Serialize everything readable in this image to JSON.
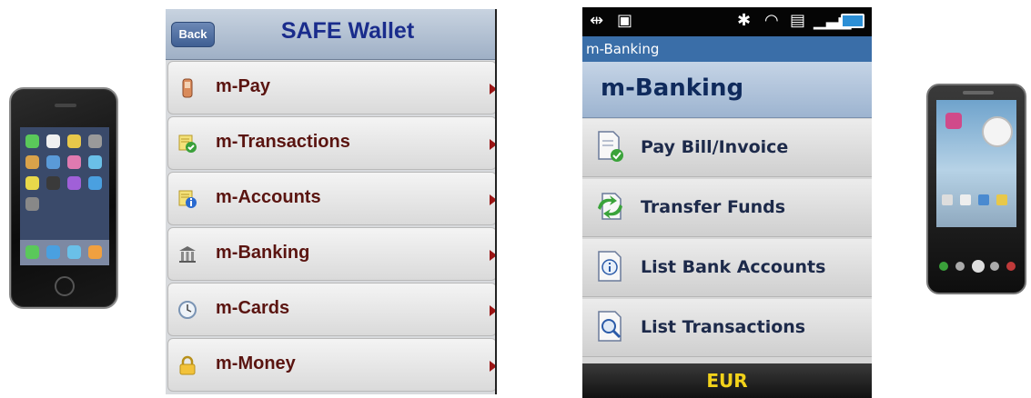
{
  "ios_app": {
    "back_label": "Back",
    "title": "SAFE Wallet",
    "menu": [
      {
        "label": "m-Pay",
        "icon": "phone-icon"
      },
      {
        "label": "m-Transactions",
        "icon": "check-document-icon"
      },
      {
        "label": "m-Accounts",
        "icon": "info-document-icon"
      },
      {
        "label": "m-Banking",
        "icon": "bank-icon"
      },
      {
        "label": "m-Cards",
        "icon": "clock-icon"
      },
      {
        "label": "m-Money",
        "icon": "lock-icon"
      }
    ]
  },
  "android_app": {
    "titlebar": "m-Banking",
    "header": "m-Banking",
    "menu": [
      {
        "label": "Pay Bill/Invoice",
        "icon": "pay-bill-icon"
      },
      {
        "label": "Transfer Funds",
        "icon": "transfer-icon"
      },
      {
        "label": "List Bank Accounts",
        "icon": "info-icon"
      },
      {
        "label": "List Transactions",
        "icon": "search-document-icon"
      }
    ],
    "currency": "EUR"
  },
  "colors": {
    "ios_title": "#1a2c8c",
    "ios_label": "#5a1410",
    "android_header": "#0f2a5c",
    "android_footer_text": "#f2d21a"
  }
}
